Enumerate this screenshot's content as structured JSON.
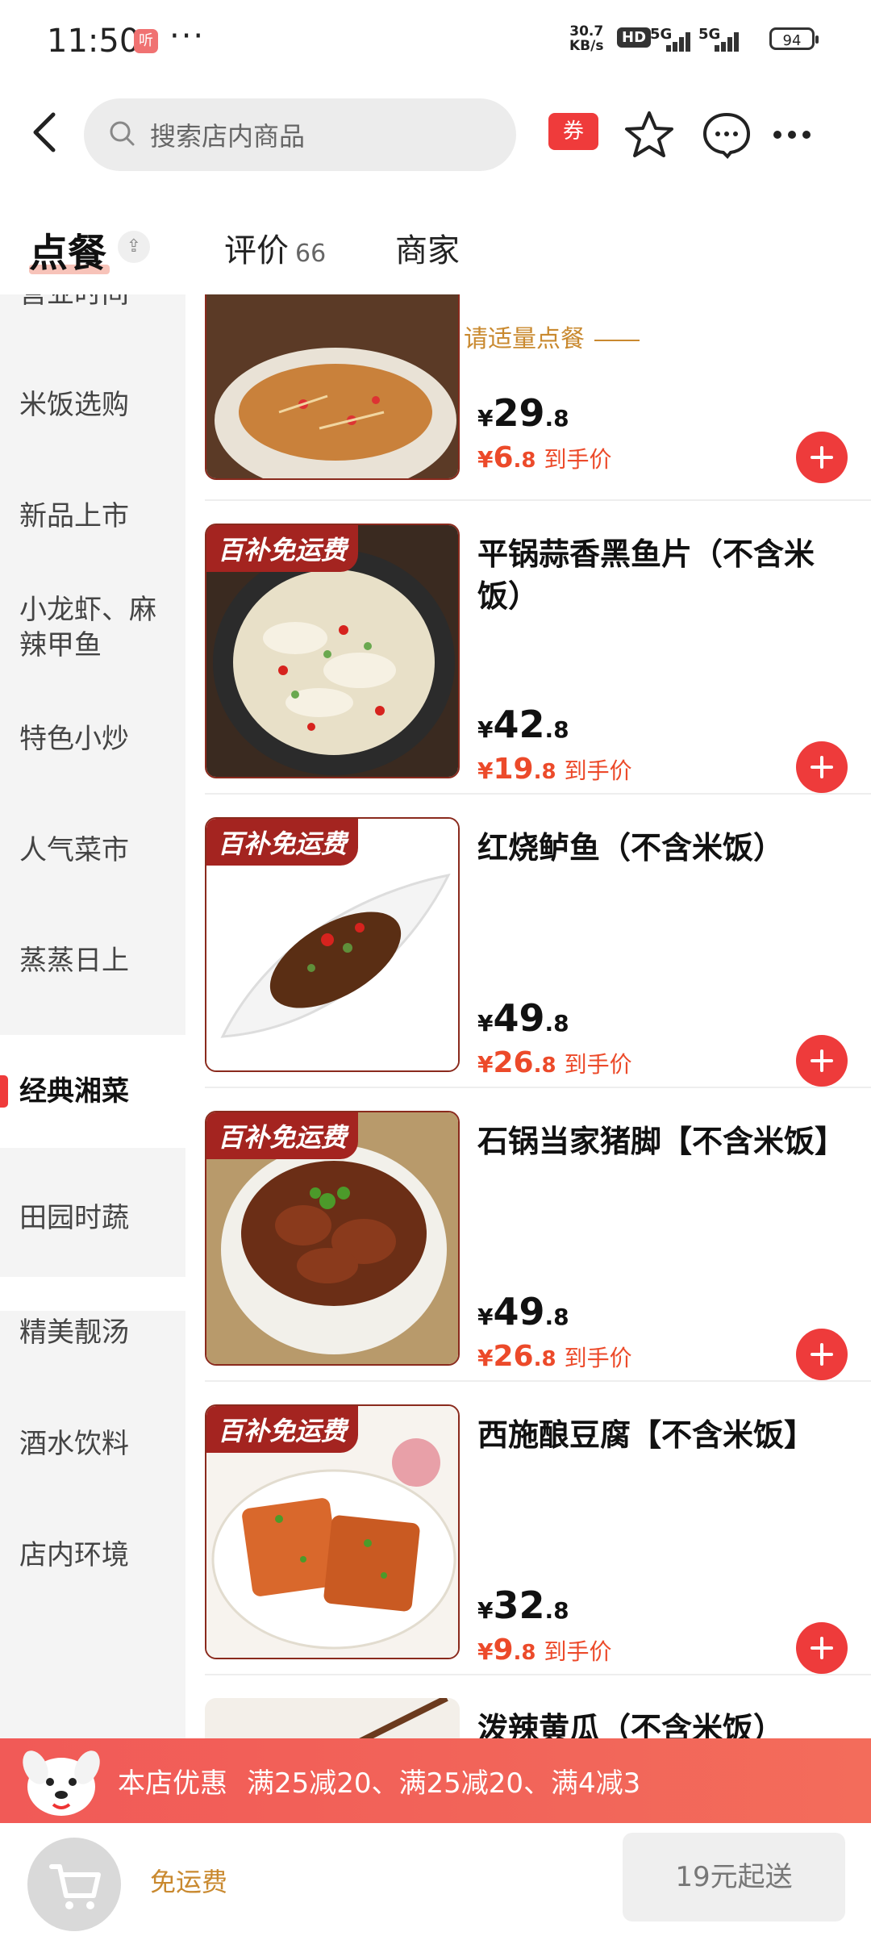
{
  "status_bar": {
    "time": "11:50",
    "app_badge": "听",
    "more": "···",
    "net_speed_value": "30.7",
    "net_speed_unit": "KB/s",
    "hd": "HD",
    "signal_1": "5G",
    "signal_2": "5G",
    "battery": "94"
  },
  "header": {
    "search_placeholder": "搜索店内商品",
    "coupon_label": "券"
  },
  "tabs": {
    "order": "点餐",
    "collapse": "⇪",
    "review": "评价",
    "review_count": "66",
    "merchant": "商家"
  },
  "sidebar": {
    "items": [
      {
        "label": "营业时间"
      },
      {
        "label": "米饭选购"
      },
      {
        "label": "新品上市"
      },
      {
        "label": "小龙虾、麻辣甲鱼"
      },
      {
        "label": "特色小炒"
      },
      {
        "label": "人气菜市"
      },
      {
        "label": "蒸蒸日上"
      },
      {
        "label": "经典湘菜",
        "active": true
      },
      {
        "label": "田园时蔬"
      },
      {
        "label": "精美靓汤"
      },
      {
        "label": "酒水饮料"
      },
      {
        "label": "店内环境"
      }
    ]
  },
  "tip": "温馨提示，请适量点餐",
  "products": [
    {
      "name": "",
      "price_int": "29",
      "price_dec": ".8",
      "deal_int": "6",
      "deal_dec": ".8",
      "deal_label": "到手价",
      "badge": ""
    },
    {
      "name": "平锅蒜香黑鱼片（不含米饭）",
      "price_int": "42",
      "price_dec": ".8",
      "deal_int": "19",
      "deal_dec": ".8",
      "deal_label": "到手价",
      "badge": "百补免运费"
    },
    {
      "name": "红烧鲈鱼（不含米饭）",
      "price_int": "49",
      "price_dec": ".8",
      "deal_int": "26",
      "deal_dec": ".8",
      "deal_label": "到手价",
      "badge": "百补免运费"
    },
    {
      "name": "石锅当家猪脚【不含米饭】",
      "price_int": "49",
      "price_dec": ".8",
      "deal_int": "26",
      "deal_dec": ".8",
      "deal_label": "到手价",
      "badge": "百补免运费"
    },
    {
      "name": "西施酿豆腐【不含米饭】",
      "price_int": "32",
      "price_dec": ".8",
      "deal_int": "9",
      "deal_dec": ".8",
      "deal_label": "到手价",
      "badge": "百补免运费"
    },
    {
      "name": "泼辣黄瓜（不含米饭）"
    }
  ],
  "currency": "¥",
  "promo": {
    "title": "本店优惠",
    "details": "满25减20、满25减20、满4减3"
  },
  "bottom": {
    "free_shipping": "免运费",
    "min_order": "19元起送"
  },
  "colors": {
    "accent": "#ee3b3b",
    "deal": "#ec4a2a",
    "tip": "#c9892f",
    "badge": "#a42420"
  }
}
